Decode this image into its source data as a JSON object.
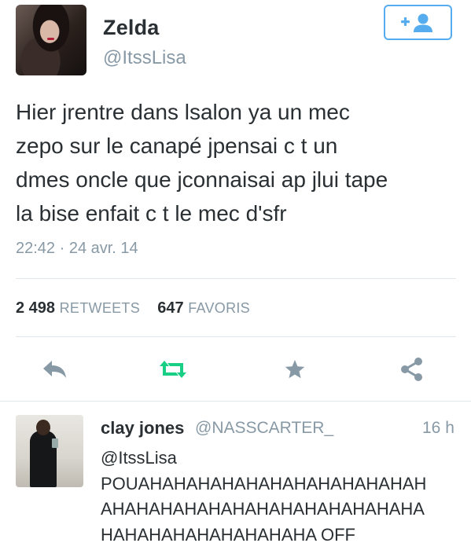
{
  "tweet": {
    "author_name": "Zelda",
    "author_handle": "@ItssLisa",
    "text_lines": [
      "Hier jrentre dans lsalon ya un mec",
      "zepo sur le canapé jpensai c t un",
      "dmes oncle que jconnaisai ap jlui tape",
      "la bise enfait c t le mec d'sfr"
    ],
    "timestamp": "22:42 · 24 avr. 14",
    "retweet_count": "2 498",
    "retweet_label": "RETWEETS",
    "favorite_count": "647",
    "favorite_label": "FAVORIS",
    "follow_icon": "add-user-icon",
    "actions": [
      "reply-icon",
      "retweet-icon",
      "favorite-star-icon",
      "share-icon"
    ]
  },
  "reply": {
    "name": "clay jones",
    "handle": "@NASSCARTER_",
    "time": "16 h",
    "text_lines": [
      "@ItssLisa",
      "POUAHAHAHAHAHAHAHAHAHAHAHAH",
      "AHAHAHAHAHAHAHAHAHAHAHAHAHA",
      "HAHAHAHAHAHAHAHAHA OFF"
    ]
  },
  "colors": {
    "accent": "#55acee",
    "retweet_green": "#19cf86",
    "muted": "#8899a6",
    "text": "#292f33",
    "icon_gray": "#8899a6"
  }
}
